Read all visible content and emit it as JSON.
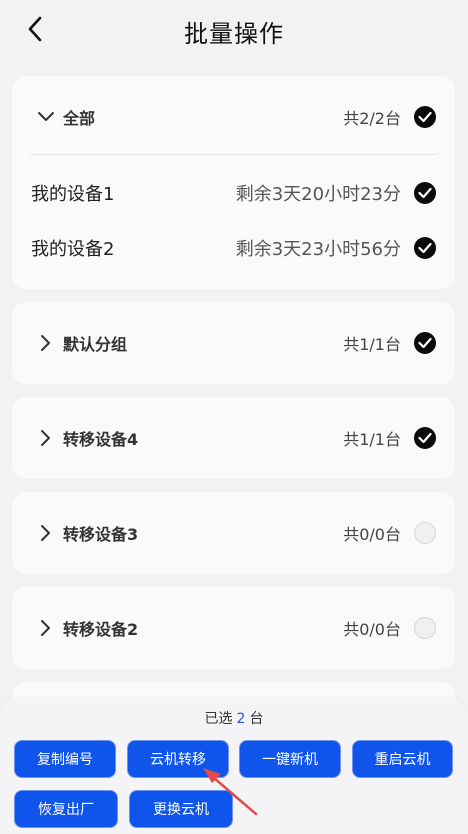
{
  "header": {
    "title": "批量操作"
  },
  "groups": [
    {
      "name": "全部",
      "count": "共2/2台",
      "checked": true,
      "expanded": true,
      "devices": [
        {
          "name": "我的设备1",
          "remaining": "剩余3天20小时23分",
          "checked": true
        },
        {
          "name": "我的设备2",
          "remaining": "剩余3天23小时56分",
          "checked": true
        }
      ]
    },
    {
      "name": "默认分组",
      "count": "共1/1台",
      "checked": true,
      "expanded": false
    },
    {
      "name": "转移设备4",
      "count": "共1/1台",
      "checked": true,
      "expanded": false
    },
    {
      "name": "转移设备3",
      "count": "共0/0台",
      "checked": false,
      "expanded": false
    },
    {
      "name": "转移设备2",
      "count": "共0/0台",
      "checked": false,
      "expanded": false
    }
  ],
  "footer": {
    "selected_prefix": "已选",
    "selected_count": "2",
    "selected_suffix": "台",
    "actions": [
      "复制编号",
      "云机转移",
      "一键新机",
      "重启云机",
      "恢复出厂",
      "更换云机"
    ]
  },
  "colors": {
    "accent": "#0f55ec",
    "checked": "#0b0b0b",
    "annotation_arrow": "#e5484d"
  }
}
